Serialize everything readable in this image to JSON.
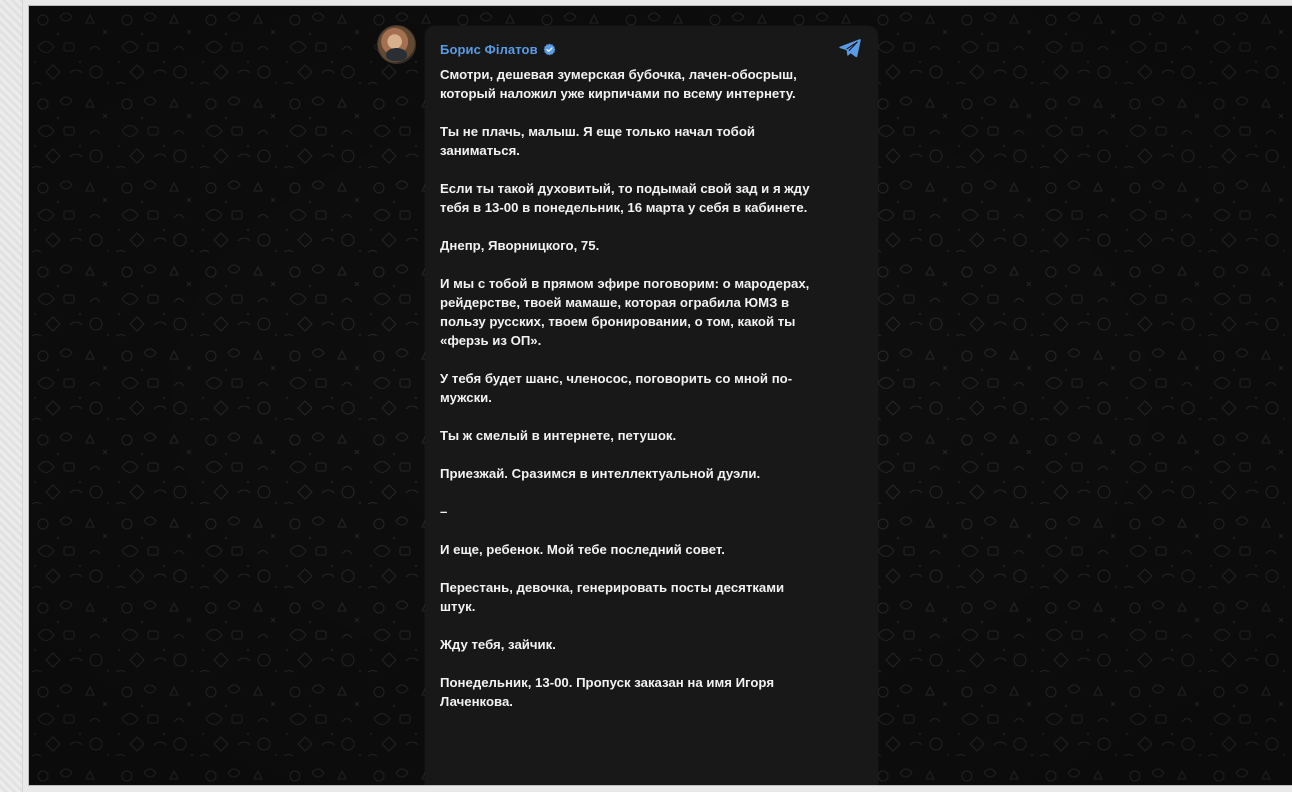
{
  "post": {
    "author": "Борис Філатов",
    "verified_icon": "verified-badge-icon",
    "share_icon": "telegram-share-icon",
    "paragraphs": [
      "Смотри, дешевая зумерская бубочка, лачен-обосрыш,\nкоторый наложил уже кирпичами по всему интернету.",
      "Ты не плачь, малыш. Я еще только начал тобой\nзаниматься.",
      "Если ты такой духовитый, то подымай свой зад и я жду\nтебя в 13-00 в понедельник, 16 марта у себя в кабинете.",
      "Днепр, Яворницкого, 75.",
      "И мы с тобой в прямом эфире поговорим: о мародерах,\nрейдерстве, твоей мамаше, которая ограбила ЮМЗ в\nпользу русских, твоем бронировании, о том, какой ты\n«ферзь из ОП».",
      "У тебя будет шанс, членосос, поговорить со мной по-\nмужски.",
      "Ты ж смелый в интернете, петушок.",
      "Приезжай. Сразимся в интеллектуальной дуэли.",
      "–",
      "И еще, ребенок. Мой тебе последний совет.",
      "Перестань, девочка, генерировать посты десятками\nштук.",
      "Жду тебя, зайчик.",
      "Понедельник, 13-00. Пропуск заказан на имя Игоря\nЛаченкова."
    ]
  },
  "colors": {
    "background": "#0e0e0e",
    "bubble": "#181818",
    "author_name": "#5a9be6",
    "text": "#f2f2f2"
  }
}
